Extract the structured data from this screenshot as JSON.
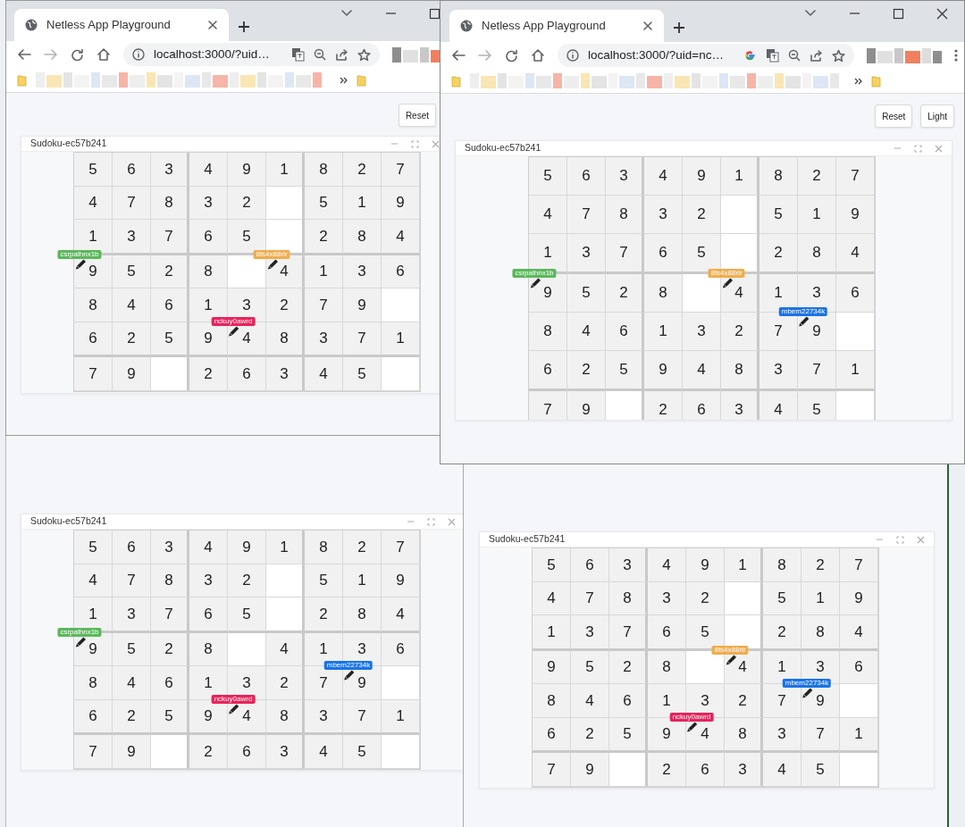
{
  "windows": [
    {
      "kind": "browser",
      "tab_title": "Netless App Playground",
      "url": "localhost:3000/?uid…",
      "buttons": [
        "Reset"
      ],
      "panel": {
        "title": "Sudoku-ec57b241",
        "rows": [
          [
            "5",
            "6",
            "3",
            "4",
            "9",
            "1",
            "8",
            "2",
            "7"
          ],
          [
            "4",
            "7",
            "8",
            "3",
            "2",
            null,
            "5",
            "1",
            "9"
          ],
          [
            "1",
            "3",
            "7",
            "6",
            "5",
            null,
            "2",
            "8",
            "4"
          ],
          [
            {
              "value": "9",
              "cursor": {
                "name": "csrpalhnx1b",
                "color": "#5cb85c"
              }
            },
            "5",
            "2",
            "8",
            null,
            {
              "value": "4",
              "cursor": {
                "name": "8fs4x88rlr",
                "color": "#f0ad4e"
              }
            },
            "1",
            "3",
            "6"
          ],
          [
            "8",
            "4",
            "6",
            "1",
            "3",
            "2",
            "7",
            "9",
            null
          ],
          [
            "6",
            "2",
            "5",
            "9",
            {
              "value": "4",
              "cursor": {
                "name": "nckuy0awrd",
                "color": "#e8235a"
              }
            },
            "8",
            "3",
            "7",
            "1"
          ],
          [
            "7",
            "9",
            null,
            "2",
            "6",
            "3",
            "4",
            "5",
            null
          ]
        ]
      }
    },
    {
      "kind": "browser",
      "tab_title": "Netless App Playground",
      "url": "localhost:3000/?uid=nc…",
      "buttons": [
        "Reset",
        "Light"
      ],
      "panel": {
        "title": "Sudoku-ec57b241",
        "rows": [
          [
            "5",
            "6",
            "3",
            "4",
            "9",
            "1",
            "8",
            "2",
            "7"
          ],
          [
            "4",
            "7",
            "8",
            "3",
            "2",
            null,
            "5",
            "1",
            "9"
          ],
          [
            "1",
            "3",
            "7",
            "6",
            "5",
            null,
            "2",
            "8",
            "4"
          ],
          [
            {
              "value": "9",
              "cursor": {
                "name": "csrpalhnx1b",
                "color": "#5cb85c"
              }
            },
            "5",
            "2",
            "8",
            null,
            {
              "value": "4",
              "cursor": {
                "name": "8fs4x88rlr",
                "color": "#f0ad4e"
              }
            },
            "1",
            "3",
            "6"
          ],
          [
            "8",
            "4",
            "6",
            "1",
            "3",
            "2",
            "7",
            {
              "value": "9",
              "cursor": {
                "name": "mbem22734k",
                "color": "#1a73e8"
              }
            },
            null
          ],
          [
            "6",
            "2",
            "5",
            "9",
            "4",
            "8",
            "3",
            "7",
            "1"
          ],
          [
            "7",
            "9",
            null,
            "2",
            "6",
            "3",
            "4",
            "5",
            null
          ]
        ]
      }
    },
    {
      "kind": "page",
      "panel": {
        "title": "Sudoku-ec57b241",
        "rows": [
          [
            "5",
            "6",
            "3",
            "4",
            "9",
            "1",
            "8",
            "2",
            "7"
          ],
          [
            "4",
            "7",
            "8",
            "3",
            "2",
            null,
            "5",
            "1",
            "9"
          ],
          [
            "1",
            "3",
            "7",
            "6",
            "5",
            null,
            "2",
            "8",
            "4"
          ],
          [
            {
              "value": "9",
              "cursor": {
                "name": "csrpalhnx1b",
                "color": "#5cb85c"
              }
            },
            "5",
            "2",
            "8",
            null,
            "4",
            "1",
            "3",
            "6"
          ],
          [
            "8",
            "4",
            "6",
            "1",
            "3",
            "2",
            "7",
            {
              "value": "9",
              "cursor": {
                "name": "mbem22734k",
                "color": "#1a73e8"
              }
            },
            null
          ],
          [
            "6",
            "2",
            "5",
            "9",
            {
              "value": "4",
              "cursor": {
                "name": "nckuy0awrd",
                "color": "#e8235a"
              }
            },
            "8",
            "3",
            "7",
            "1"
          ],
          [
            "7",
            "9",
            null,
            "2",
            "6",
            "3",
            "4",
            "5",
            null
          ]
        ]
      }
    },
    {
      "kind": "page",
      "panel": {
        "title": "Sudoku-ec57b241",
        "rows": [
          [
            "5",
            "6",
            "3",
            "4",
            "9",
            "1",
            "8",
            "2",
            "7"
          ],
          [
            "4",
            "7",
            "8",
            "3",
            "2",
            null,
            "5",
            "1",
            "9"
          ],
          [
            "1",
            "3",
            "7",
            "6",
            "5",
            null,
            "2",
            "8",
            "4"
          ],
          [
            "9",
            "5",
            "2",
            "8",
            null,
            {
              "value": "4",
              "cursor": {
                "name": "8fs4x88rlr",
                "color": "#f0ad4e"
              }
            },
            "1",
            "3",
            "6"
          ],
          [
            "8",
            "4",
            "6",
            "1",
            "3",
            "2",
            "7",
            {
              "value": "9",
              "cursor": {
                "name": "mbem22734k",
                "color": "#1a73e8"
              }
            },
            null
          ],
          [
            "6",
            "2",
            "5",
            "9",
            {
              "value": "4",
              "cursor": {
                "name": "nckuy0awrd",
                "color": "#e8235a"
              }
            },
            "8",
            "3",
            "7",
            "1"
          ],
          [
            "7",
            "9",
            null,
            "2",
            "6",
            "3",
            "4",
            "5",
            null
          ]
        ]
      }
    }
  ]
}
